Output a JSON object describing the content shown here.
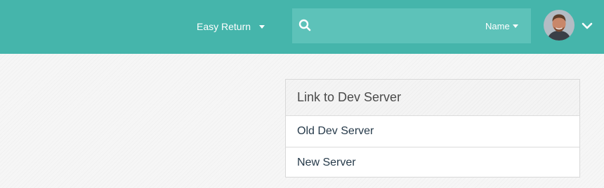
{
  "header": {
    "org_selector_label": "Easy Return",
    "search": {
      "placeholder": "",
      "value": "",
      "filter_label": "Name"
    },
    "user_menu": {
      "avatar_icon": "user-avatar-photo",
      "chevron_icon": "chevron-down-icon"
    },
    "background_color": "#45b5ab"
  },
  "panel": {
    "title": "Link to Dev Server",
    "items": [
      {
        "label": "Old Dev Server"
      },
      {
        "label": "New Server"
      }
    ]
  }
}
